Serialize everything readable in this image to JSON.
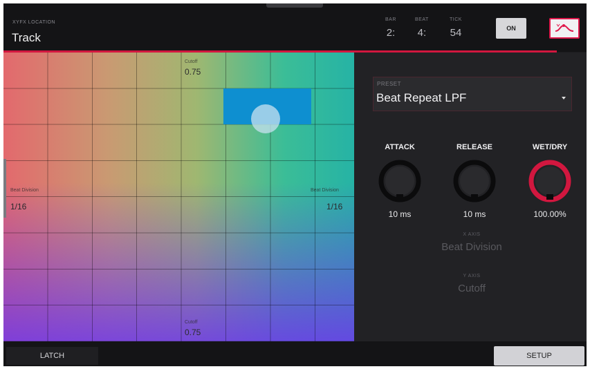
{
  "header": {
    "location_label": "XYFX LOCATION",
    "location_value": "Track",
    "bar_label": "BAR",
    "bar_value": "2:",
    "beat_label": "BEAT",
    "beat_value": "4:",
    "tick_label": "TICK",
    "tick_value": "54",
    "on_button": "ON",
    "fx_icon": "xy-curve-icon"
  },
  "pad": {
    "top_label": "Cutoff",
    "top_value": "0.75",
    "bottom_label": "Cutoff",
    "bottom_value": "0.75",
    "left_label": "Beat Division",
    "left_value": "1/16",
    "right_label": "Beat Division",
    "right_value": "1/16"
  },
  "preset": {
    "label": "PRESET",
    "value": "Beat Repeat LPF"
  },
  "knobs": [
    {
      "label": "ATTACK",
      "value": "10 ms",
      "level": 0.0
    },
    {
      "label": "RELEASE",
      "value": "10 ms",
      "level": 0.0
    },
    {
      "label": "WET/DRY",
      "value": "100.00%",
      "level": 1.0
    }
  ],
  "axes": {
    "x_label": "X AXIS",
    "x_value": "Beat Division",
    "y_label": "Y AXIS",
    "y_value": "Cutoff"
  },
  "footer": {
    "latch": "LATCH",
    "setup": "SETUP"
  },
  "colors": {
    "accent": "#d2173f",
    "active_cell": "#0e8fd0"
  }
}
